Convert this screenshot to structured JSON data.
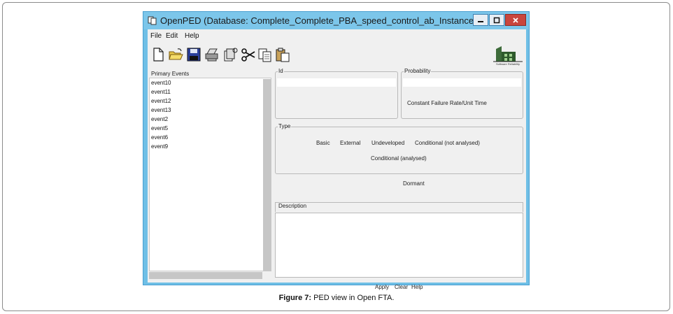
{
  "window": {
    "title": "OpenPED (Database: Complete_Complete_PBA_speed_control_ab_Instance__FTA.pe..."
  },
  "menu": [
    "File",
    "Edit",
    "Help"
  ],
  "toolbar": {
    "icons": [
      "new-file-icon",
      "open-folder-icon",
      "save-icon",
      "print-icon",
      "export-icon",
      "cut-icon",
      "copy-icon",
      "paste-icon"
    ],
    "logo_caption": "Software Reliability"
  },
  "primary_events": {
    "legend": "Primary Events",
    "items": [
      "event10",
      "event11",
      "event12",
      "event13",
      "event2",
      "event5",
      "event6",
      "event9"
    ]
  },
  "id_group": {
    "legend": "Id"
  },
  "probability_group": {
    "legend": "Probability",
    "unit_label": "Constant Failure Rate/Unit Time"
  },
  "type_group": {
    "legend": "Type",
    "options": [
      "Basic",
      "External",
      "Undeveloped",
      "Conditional (not analysed)",
      "Conditional (analysed)"
    ]
  },
  "dormant_label": "Dormant",
  "description_group": {
    "legend": "Description"
  },
  "buttons": {
    "apply": "Apply",
    "clear": "Clear",
    "help": "Help"
  },
  "caption": {
    "label": "Figure 7:",
    "text": " PED view in Open FTA."
  },
  "colors": {
    "titlebar": "#7cc6ea",
    "close_button": "#c9463d",
    "client_bg": "#f0f0f0"
  }
}
